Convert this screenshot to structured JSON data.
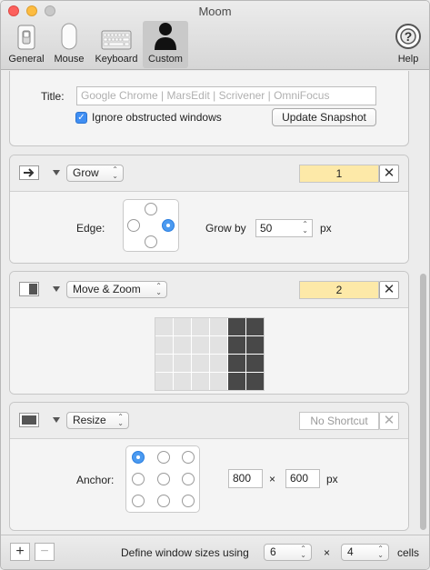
{
  "window": {
    "title": "Moom"
  },
  "toolbar": {
    "items": [
      {
        "label": "General",
        "icon": "general-switch-icon"
      },
      {
        "label": "Mouse",
        "icon": "mouse-icon"
      },
      {
        "label": "Keyboard",
        "icon": "keyboard-icon"
      },
      {
        "label": "Custom",
        "icon": "person-silhouette-icon",
        "active": true
      },
      {
        "label": "Help",
        "icon": "help-lifebuoy-icon"
      }
    ]
  },
  "snapshot": {
    "title_label": "Title:",
    "title_placeholder": "Google Chrome | MarsEdit | Scrivener | OmniFocus",
    "ignore_label": "Ignore obstructed windows",
    "ignore_checked": true,
    "update_button": "Update Snapshot"
  },
  "grow": {
    "action": "Grow",
    "shortcut": "1",
    "edge_label": "Edge:",
    "selected_edge": "right",
    "grow_by_label": "Grow by",
    "grow_by_value": "50",
    "unit": "px",
    "remove_label": "✕"
  },
  "move_zoom": {
    "action": "Move & Zoom",
    "shortcut": "2",
    "grid_cols": 6,
    "grid_rows": 4,
    "selected_cols": [
      5,
      6
    ],
    "remove_label": "✕"
  },
  "resize": {
    "action": "Resize",
    "shortcut": "No Shortcut",
    "anchor_label": "Anchor:",
    "selected_anchor": "top-left",
    "width": "800",
    "height": "600",
    "times": "×",
    "unit": "px",
    "remove_label": "✕"
  },
  "footer": {
    "add_label": "+",
    "remove_label": "−",
    "define_label": "Define window sizes using",
    "cols_value": "6",
    "times": "×",
    "rows_value": "4",
    "cells_label": "cells"
  },
  "colors": {
    "shortcut_fill": "#fde9a8",
    "accent": "#4b9af0",
    "selected_cell": "#484848"
  }
}
